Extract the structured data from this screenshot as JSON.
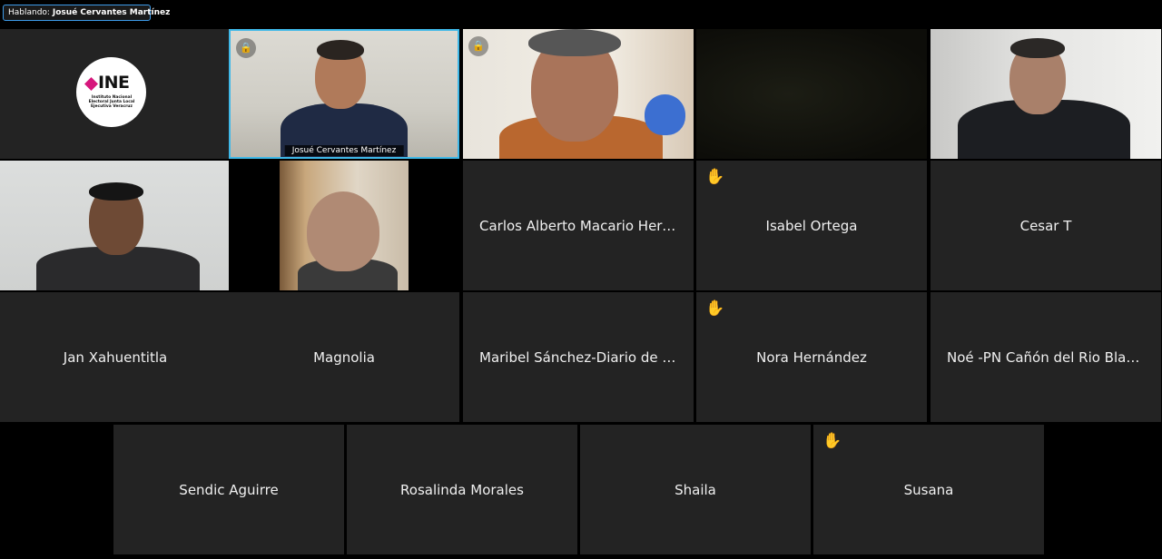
{
  "speaking_banner": {
    "label": "Hablando:",
    "speaker": "Josué Cervantes Martínez"
  },
  "logo": {
    "text": "INE",
    "subtitle": "Instituto Nacional Electoral Junta Local Ejecutiva Veracruz",
    "accent": "#d6177c"
  },
  "video_tiles": {
    "josue_caption": "Josué Cervantes Martínez"
  },
  "name_tiles": [
    {
      "name": "Carlos Alberto Macario Hern...",
      "hand_raised": false
    },
    {
      "name": "Isabel Ortega",
      "hand_raised": true
    },
    {
      "name": "Cesar T",
      "hand_raised": false
    },
    {
      "name": "Jan Xahuentitla",
      "hand_raised": false
    },
    {
      "name": "Magnolia",
      "hand_raised": false
    },
    {
      "name": "Maribel Sánchez-Diario de X...",
      "hand_raised": false
    },
    {
      "name": "Nora Hernández",
      "hand_raised": true
    },
    {
      "name": "Noé -PN Cañón del Rio Blan...",
      "hand_raised": false
    },
    {
      "name": "Sendic Aguirre",
      "hand_raised": false
    },
    {
      "name": "Rosalinda Morales",
      "hand_raised": false
    },
    {
      "name": "Shaila",
      "hand_raised": false
    },
    {
      "name": "Susana",
      "hand_raised": true
    }
  ],
  "icons": {
    "hand": "raised-hand-icon",
    "lock": "lock-icon"
  },
  "colors": {
    "active_speaker_border": "#3fb8e8",
    "tile_bg": "#232323",
    "hand": "#f5b301"
  }
}
